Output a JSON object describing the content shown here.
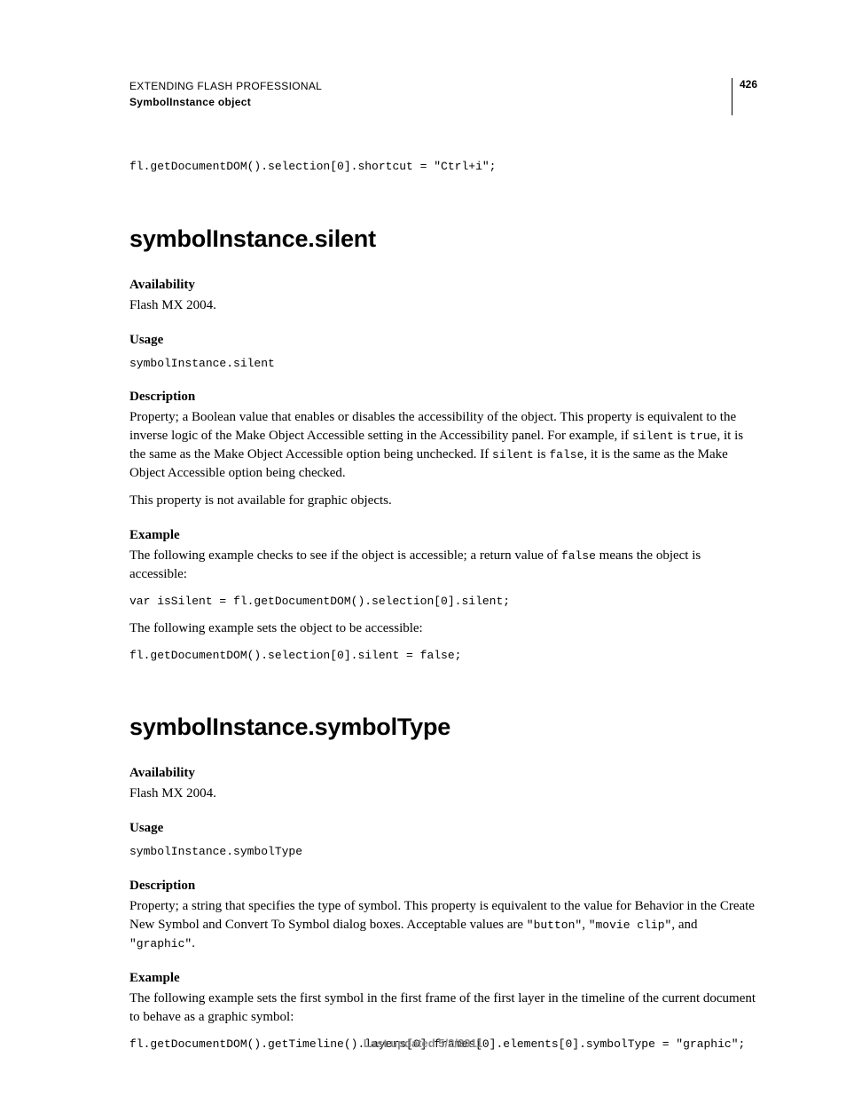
{
  "header": {
    "line1": "EXTENDING FLASH PROFESSIONAL",
    "line2": "SymbolInstance object",
    "page_number": "426"
  },
  "intro_code": "fl.getDocumentDOM().selection[0].shortcut = \"Ctrl+i\";",
  "section1": {
    "title": "symbolInstance.silent",
    "availability_label": "Availability",
    "availability_text": "Flash MX 2004.",
    "usage_label": "Usage",
    "usage_code": "symbolInstance.silent",
    "description_label": "Description",
    "desc_p1_a": "Property; a Boolean value that enables or disables the accessibility of the object. This property is equivalent to the inverse logic of the Make Object Accessible setting in the Accessibility panel. For example, if ",
    "desc_p1_code1": "silent",
    "desc_p1_b": " is ",
    "desc_p1_code2": "true",
    "desc_p1_c": ", it is the same as the Make Object Accessible option being unchecked. If ",
    "desc_p1_code3": "silent",
    "desc_p1_d": " is ",
    "desc_p1_code4": "false",
    "desc_p1_e": ", it is the same as the Make Object Accessible option being checked.",
    "desc_p2": "This property is not available for graphic objects.",
    "example_label": "Example",
    "ex_p1_a": "The following example checks to see if the object is accessible; a return value of ",
    "ex_p1_code": "false",
    "ex_p1_b": " means the object is accessible:",
    "ex_code1": "var isSilent = fl.getDocumentDOM().selection[0].silent;",
    "ex_p2": "The following example sets the object to be accessible:",
    "ex_code2": "fl.getDocumentDOM().selection[0].silent = false;"
  },
  "section2": {
    "title": "symbolInstance.symbolType",
    "availability_label": "Availability",
    "availability_text": "Flash MX 2004.",
    "usage_label": "Usage",
    "usage_code": "symbolInstance.symbolType",
    "description_label": "Description",
    "desc_a": "Property; a string that specifies the type of symbol. This property is equivalent to the value for Behavior in the Create New Symbol and Convert To Symbol dialog boxes. Acceptable values are ",
    "desc_code1": "\"button\"",
    "desc_b": ", ",
    "desc_code2": "\"movie clip\"",
    "desc_c": ", and ",
    "desc_code3": "\"graphic\"",
    "desc_d": ".",
    "example_label": "Example",
    "ex_p1": "The following example sets the first symbol in the first frame of the first layer in the timeline of the current document to behave as a graphic symbol:",
    "ex_code": "fl.getDocumentDOM().getTimeline().layers[0].frames[0].elements[0].symbolType = \"graphic\";"
  },
  "footer": "Last updated 5/2/2011"
}
